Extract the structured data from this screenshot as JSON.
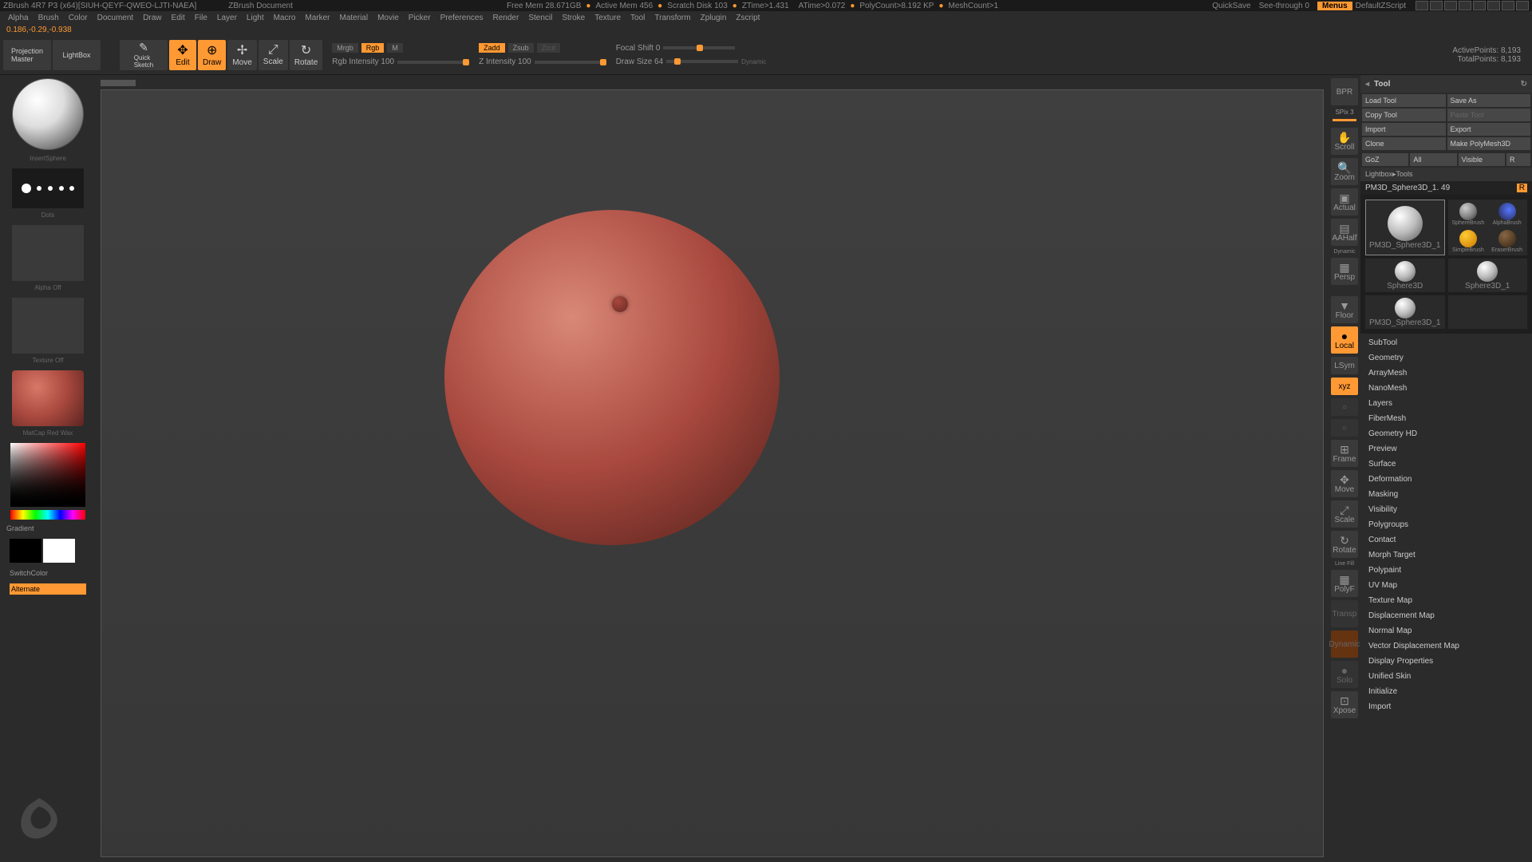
{
  "title": {
    "app": "ZBrush 4R7 P3 (x64)[SIUH-QEYF-QWEO-LJTI-NAEA]",
    "doc": "ZBrush Document",
    "stats": {
      "freemem": "Free Mem 28.671GB",
      "activemem": "Active Mem 456",
      "scratch": "Scratch Disk 103",
      "ztime": "ZTime>1.431",
      "atime": "ATime>0.072",
      "polycount": "PolyCount>8.192 KP",
      "meshcount": "MeshCount>1"
    },
    "quicksave": "QuickSave",
    "seethrough": "See-through  0",
    "menus": "Menus",
    "defaultscript": "DefaultZScript"
  },
  "menus": [
    "Alpha",
    "Brush",
    "Color",
    "Document",
    "Draw",
    "Edit",
    "File",
    "Layer",
    "Light",
    "Macro",
    "Marker",
    "Material",
    "Movie",
    "Picker",
    "Preferences",
    "Render",
    "Stencil",
    "Stroke",
    "Texture",
    "Tool",
    "Transform",
    "Zplugin",
    "Zscript"
  ],
  "coords": "0.186,-0.29,-0.938",
  "toolbar": {
    "projection": "Projection\nMaster",
    "lightbox": "LightBox",
    "quicksketch": "Quick\nSketch",
    "edit": "Edit",
    "draw": "Draw",
    "move": "Move",
    "scale": "Scale",
    "rotate": "Rotate",
    "mrgb": "Mrgb",
    "rgb": "Rgb",
    "m": "M",
    "rgbint": "Rgb Intensity 100",
    "zadd": "Zadd",
    "zsub": "Zsub",
    "zcut": "Zcut",
    "zint": "Z Intensity 100",
    "focal": "Focal Shift 0",
    "drawsize": "Draw Size 64",
    "dynamic": "Dynamic",
    "activepts": "ActivePoints: 8,193",
    "totalpts": "TotalPoints: 8,193"
  },
  "left": {
    "brush": "InsertSphere",
    "stroke": "Dots",
    "alpha": "Alpha Off",
    "texture": "Texture Off",
    "material": "MatCap Red Wax",
    "gradient": "Gradient",
    "switchcolor": "SwitchColor",
    "alternate": "Alternate"
  },
  "shelf": {
    "bpr": "BPR",
    "spix": "SPix 3",
    "scroll": "Scroll",
    "zoom": "Zoom",
    "actual": "Actual",
    "aahalf": "AAHalf",
    "dynamic_lbl": "Dynamic",
    "persp": "Persp",
    "floor": "Floor",
    "local": "Local",
    "lsym": "LSym",
    "xyz": "xyz",
    "frame": "Frame",
    "moveb": "Move",
    "scaleb": "Scale",
    "rotateb": "Rotate",
    "linefill": "Line Fill",
    "polyf": "PolyF",
    "transp": "Transp",
    "dynamic2": "Dynamic",
    "solo": "Solo",
    "xpose": "Xpose"
  },
  "right": {
    "hdr": "Tool",
    "loadtool": "Load Tool",
    "saveas": "Save As",
    "copytool": "Copy Tool",
    "pastetool": "Paste Tool",
    "import": "Import",
    "export": "Export",
    "clone": "Clone",
    "makepm": "Make PolyMesh3D",
    "goz": "GoZ",
    "all": "All",
    "visible": "Visible",
    "r": "R",
    "lbtools": "Lightbox▸Tools",
    "pmname": "PM3D_Sphere3D_1. 49",
    "tools": {
      "t1": "PM3D_Sphere3D_1",
      "t2": "SphereBrush",
      "t3": "AlphaBrush",
      "t4": "SimpleBrush",
      "t5": "EraserBrush",
      "t6": "Sphere3D",
      "t7": "Sphere3D_1",
      "t8": "PM3D_Sphere3D_1"
    },
    "sections": [
      "SubTool",
      "Geometry",
      "ArrayMesh",
      "NanoMesh",
      "Layers",
      "FiberMesh",
      "Geometry HD",
      "Preview",
      "Surface",
      "Deformation",
      "Masking",
      "Visibility",
      "Polygroups",
      "Contact",
      "Morph Target",
      "Polypaint",
      "UV Map",
      "Texture Map",
      "Displacement Map",
      "Normal Map",
      "Vector Displacement Map",
      "Display Properties",
      "Unified Skin",
      "Initialize",
      "Import"
    ]
  }
}
